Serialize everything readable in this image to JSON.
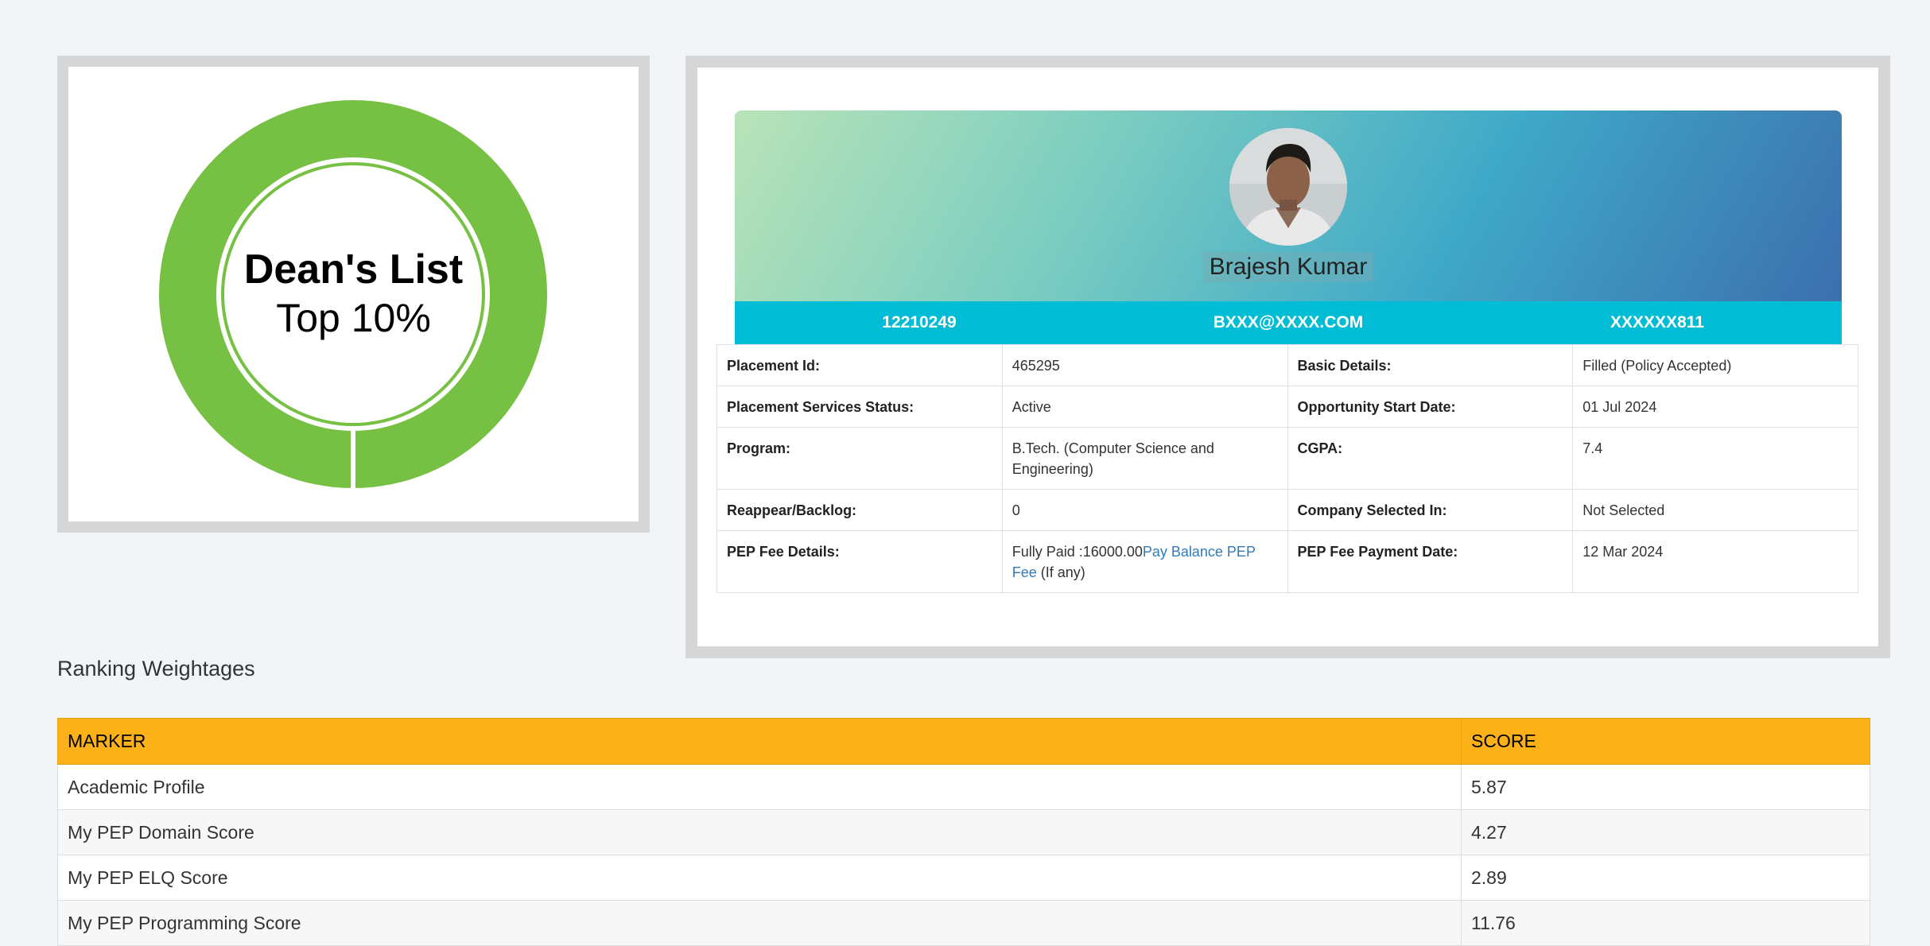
{
  "badge": {
    "title": "Dean's List",
    "subtitle": "Top 10%",
    "ring_color": "#76c043"
  },
  "profile": {
    "name": "Brajesh Kumar",
    "registration_no": "12210249",
    "email": "BXXX@XXXX.COM",
    "phone": "XXXXXX811",
    "details": [
      {
        "label1": "Placement Id:",
        "value1": "465295",
        "label2": "Basic Details:",
        "value2": "Filled (Policy Accepted)"
      },
      {
        "label1": "Placement Services Status:",
        "value1": "Active",
        "label2": "Opportunity Start Date:",
        "value2": "01 Jul 2024"
      },
      {
        "label1": "Program:",
        "value1": "B.Tech. (Computer Science and Engineering)",
        "label2": "CGPA:",
        "value2": "7.4"
      },
      {
        "label1": "Reappear/Backlog:",
        "value1": "0",
        "label2": "Company Selected In:",
        "value2": "Not Selected"
      },
      {
        "label1": "PEP Fee Details:",
        "value1_prefix": "Fully Paid :16000.00",
        "value1_link": "Pay Balance PEP Fee",
        "value1_suffix": " (If any)",
        "label2": "PEP Fee Payment Date:",
        "value2": "12 Mar 2024"
      }
    ]
  },
  "ranking": {
    "title": "Ranking Weightages",
    "headers": [
      "MARKER",
      "SCORE"
    ],
    "rows": [
      {
        "marker": "Academic Profile",
        "score": "5.87"
      },
      {
        "marker": "My PEP Domain Score",
        "score": "4.27"
      },
      {
        "marker": "My PEP ELQ Score",
        "score": "2.89"
      },
      {
        "marker": "My PEP Programming Score",
        "score": "11.76"
      }
    ]
  },
  "colors": {
    "id_bar": "#00bcd4",
    "table_header": "#fbb117",
    "link": "#337ab7"
  }
}
